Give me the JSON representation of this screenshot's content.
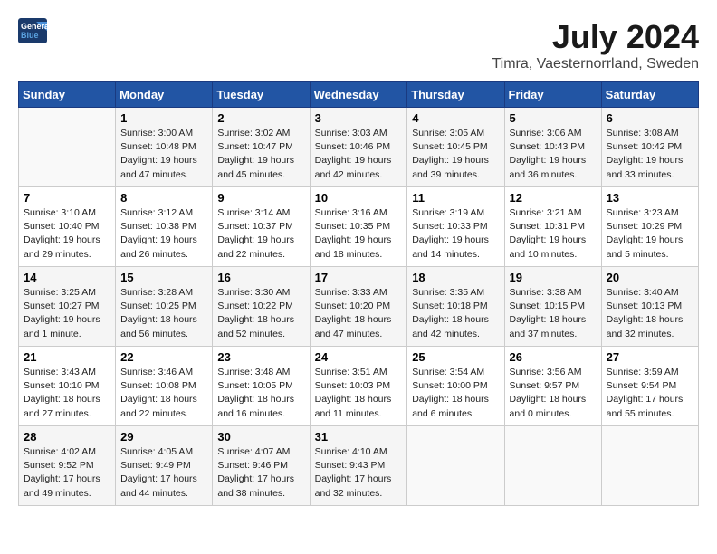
{
  "header": {
    "logo_line1": "General",
    "logo_line2": "Blue",
    "month_year": "July 2024",
    "location": "Timra, Vaesternorrland, Sweden"
  },
  "columns": [
    "Sunday",
    "Monday",
    "Tuesday",
    "Wednesday",
    "Thursday",
    "Friday",
    "Saturday"
  ],
  "weeks": [
    [
      {
        "day": "",
        "info": ""
      },
      {
        "day": "1",
        "info": "Sunrise: 3:00 AM\nSunset: 10:48 PM\nDaylight: 19 hours\nand 47 minutes."
      },
      {
        "day": "2",
        "info": "Sunrise: 3:02 AM\nSunset: 10:47 PM\nDaylight: 19 hours\nand 45 minutes."
      },
      {
        "day": "3",
        "info": "Sunrise: 3:03 AM\nSunset: 10:46 PM\nDaylight: 19 hours\nand 42 minutes."
      },
      {
        "day": "4",
        "info": "Sunrise: 3:05 AM\nSunset: 10:45 PM\nDaylight: 19 hours\nand 39 minutes."
      },
      {
        "day": "5",
        "info": "Sunrise: 3:06 AM\nSunset: 10:43 PM\nDaylight: 19 hours\nand 36 minutes."
      },
      {
        "day": "6",
        "info": "Sunrise: 3:08 AM\nSunset: 10:42 PM\nDaylight: 19 hours\nand 33 minutes."
      }
    ],
    [
      {
        "day": "7",
        "info": "Sunrise: 3:10 AM\nSunset: 10:40 PM\nDaylight: 19 hours\nand 29 minutes."
      },
      {
        "day": "8",
        "info": "Sunrise: 3:12 AM\nSunset: 10:38 PM\nDaylight: 19 hours\nand 26 minutes."
      },
      {
        "day": "9",
        "info": "Sunrise: 3:14 AM\nSunset: 10:37 PM\nDaylight: 19 hours\nand 22 minutes."
      },
      {
        "day": "10",
        "info": "Sunrise: 3:16 AM\nSunset: 10:35 PM\nDaylight: 19 hours\nand 18 minutes."
      },
      {
        "day": "11",
        "info": "Sunrise: 3:19 AM\nSunset: 10:33 PM\nDaylight: 19 hours\nand 14 minutes."
      },
      {
        "day": "12",
        "info": "Sunrise: 3:21 AM\nSunset: 10:31 PM\nDaylight: 19 hours\nand 10 minutes."
      },
      {
        "day": "13",
        "info": "Sunrise: 3:23 AM\nSunset: 10:29 PM\nDaylight: 19 hours\nand 5 minutes."
      }
    ],
    [
      {
        "day": "14",
        "info": "Sunrise: 3:25 AM\nSunset: 10:27 PM\nDaylight: 19 hours\nand 1 minute."
      },
      {
        "day": "15",
        "info": "Sunrise: 3:28 AM\nSunset: 10:25 PM\nDaylight: 18 hours\nand 56 minutes."
      },
      {
        "day": "16",
        "info": "Sunrise: 3:30 AM\nSunset: 10:22 PM\nDaylight: 18 hours\nand 52 minutes."
      },
      {
        "day": "17",
        "info": "Sunrise: 3:33 AM\nSunset: 10:20 PM\nDaylight: 18 hours\nand 47 minutes."
      },
      {
        "day": "18",
        "info": "Sunrise: 3:35 AM\nSunset: 10:18 PM\nDaylight: 18 hours\nand 42 minutes."
      },
      {
        "day": "19",
        "info": "Sunrise: 3:38 AM\nSunset: 10:15 PM\nDaylight: 18 hours\nand 37 minutes."
      },
      {
        "day": "20",
        "info": "Sunrise: 3:40 AM\nSunset: 10:13 PM\nDaylight: 18 hours\nand 32 minutes."
      }
    ],
    [
      {
        "day": "21",
        "info": "Sunrise: 3:43 AM\nSunset: 10:10 PM\nDaylight: 18 hours\nand 27 minutes."
      },
      {
        "day": "22",
        "info": "Sunrise: 3:46 AM\nSunset: 10:08 PM\nDaylight: 18 hours\nand 22 minutes."
      },
      {
        "day": "23",
        "info": "Sunrise: 3:48 AM\nSunset: 10:05 PM\nDaylight: 18 hours\nand 16 minutes."
      },
      {
        "day": "24",
        "info": "Sunrise: 3:51 AM\nSunset: 10:03 PM\nDaylight: 18 hours\nand 11 minutes."
      },
      {
        "day": "25",
        "info": "Sunrise: 3:54 AM\nSunset: 10:00 PM\nDaylight: 18 hours\nand 6 minutes."
      },
      {
        "day": "26",
        "info": "Sunrise: 3:56 AM\nSunset: 9:57 PM\nDaylight: 18 hours\nand 0 minutes."
      },
      {
        "day": "27",
        "info": "Sunrise: 3:59 AM\nSunset: 9:54 PM\nDaylight: 17 hours\nand 55 minutes."
      }
    ],
    [
      {
        "day": "28",
        "info": "Sunrise: 4:02 AM\nSunset: 9:52 PM\nDaylight: 17 hours\nand 49 minutes."
      },
      {
        "day": "29",
        "info": "Sunrise: 4:05 AM\nSunset: 9:49 PM\nDaylight: 17 hours\nand 44 minutes."
      },
      {
        "day": "30",
        "info": "Sunrise: 4:07 AM\nSunset: 9:46 PM\nDaylight: 17 hours\nand 38 minutes."
      },
      {
        "day": "31",
        "info": "Sunrise: 4:10 AM\nSunset: 9:43 PM\nDaylight: 17 hours\nand 32 minutes."
      },
      {
        "day": "",
        "info": ""
      },
      {
        "day": "",
        "info": ""
      },
      {
        "day": "",
        "info": ""
      }
    ]
  ]
}
